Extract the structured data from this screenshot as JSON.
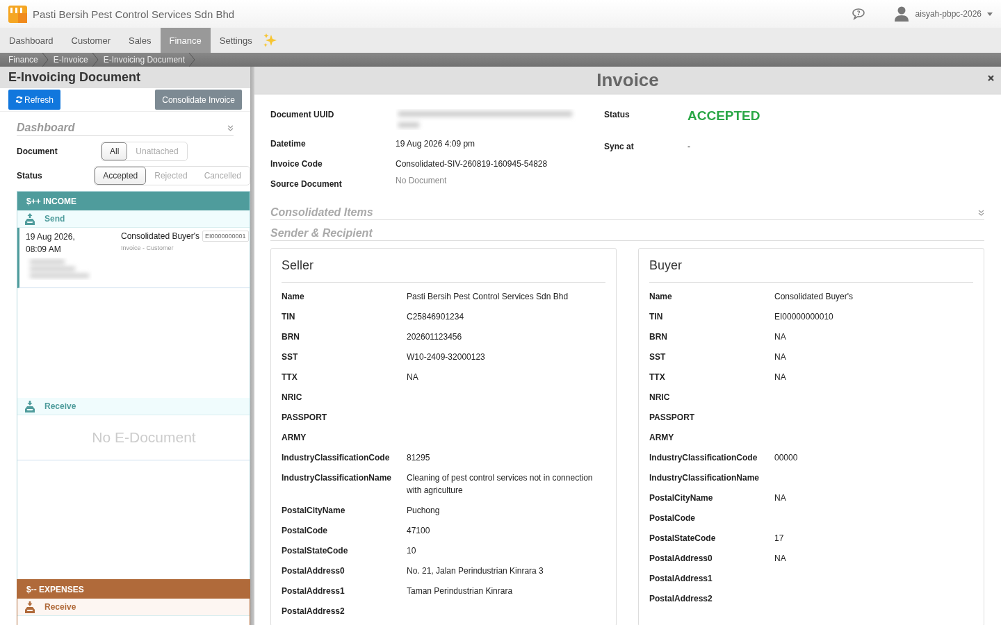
{
  "app": {
    "name": "Pasti Bersih Pest Control Services Sdn Bhd"
  },
  "user": {
    "name": "aisyah-pbpc-2026"
  },
  "nav": [
    {
      "label": "Dashboard",
      "selected": false
    },
    {
      "label": "Customer",
      "selected": false
    },
    {
      "label": "Sales",
      "selected": false
    },
    {
      "label": "Finance",
      "selected": true
    },
    {
      "label": "Settings",
      "selected": false
    }
  ],
  "breadcrumbs": [
    "Finance",
    "E-Invoice",
    "E-Invoicing Document"
  ],
  "left": {
    "title": "E-Invoicing Document",
    "refresh": "Refresh",
    "consolidate": "Consolidate Invoice",
    "dashboard": "Dashboard",
    "filters": [
      {
        "label": "Document",
        "options": [
          {
            "label": "All",
            "selected": true
          },
          {
            "label": "Unattached",
            "selected": false
          }
        ]
      },
      {
        "label": "Status",
        "options": [
          {
            "label": "Accepted",
            "selected": true
          },
          {
            "label": "Rejected",
            "selected": false
          },
          {
            "label": "Cancelled",
            "selected": false
          }
        ]
      }
    ],
    "groups": [
      {
        "kind": "income",
        "title": "$++ INCOME",
        "sections": [
          {
            "label": "Send",
            "kind": "send",
            "items": [
              {
                "date": "19 Aug 2026,",
                "time": "08:09 AM",
                "name": "Consolidated Buyer's",
                "tag": "EI0000000001",
                "subtitle": "Invoice - Customer"
              }
            ]
          },
          {
            "label": "Receive",
            "kind": "receive",
            "empty": "No E-Document"
          }
        ]
      },
      {
        "kind": "expenses",
        "title": "$-- EXPENSES",
        "sections": [
          {
            "label": "Receive",
            "kind": "receive"
          }
        ]
      }
    ]
  },
  "modal": {
    "title": "Invoice",
    "fields": [
      {
        "label": "Document UUID",
        "kind": "blurred"
      },
      {
        "label": "Datetime",
        "value": "19 Aug 2026 4:09 pm",
        "kind": "text"
      },
      {
        "label": "Invoice Code",
        "value": "Consolidated-SIV-260819-160945-54828",
        "kind": "text"
      },
      {
        "label": "Source Document",
        "value": "No Document",
        "kind": "muted"
      }
    ],
    "status": {
      "label": "Status",
      "value": "ACCEPTED"
    },
    "sync": {
      "label": "Sync at",
      "value": "-"
    },
    "sections": [
      "Consolidated Items",
      "Sender & Recipient"
    ],
    "parties": [
      {
        "title": "Seller",
        "rows": [
          {
            "label": "Name",
            "value": "Pasti Bersih Pest Control Services Sdn Bhd"
          },
          {
            "label": "TIN",
            "value": "C25846901234"
          },
          {
            "label": "BRN",
            "value": "202601123456"
          },
          {
            "label": "SST",
            "value": "W10-2409-32000123"
          },
          {
            "label": "TTX",
            "value": "NA"
          },
          {
            "label": "NRIC"
          },
          {
            "label": "PASSPORT"
          },
          {
            "label": "ARMY"
          },
          {
            "label": "IndustryClassificationCode",
            "value": "81295"
          },
          {
            "label": "IndustryClassificationName",
            "value": "Cleaning of pest control services not in connection with agriculture"
          },
          {
            "label": "PostalCityName",
            "value": "Puchong"
          },
          {
            "label": "PostalCode",
            "value": "47100"
          },
          {
            "label": "PostalStateCode",
            "value": "10"
          },
          {
            "label": "PostalAddress0",
            "value": "No. 21, Jalan Perindustrian Kinrara 3"
          },
          {
            "label": "PostalAddress1",
            "value": "Taman Perindustrian Kinrara"
          },
          {
            "label": "PostalAddress2"
          }
        ]
      },
      {
        "title": "Buyer",
        "rows": [
          {
            "label": "Name",
            "value": "Consolidated Buyer's"
          },
          {
            "label": "TIN",
            "value": "EI00000000010"
          },
          {
            "label": "BRN",
            "value": "NA"
          },
          {
            "label": "SST",
            "value": "NA"
          },
          {
            "label": "TTX",
            "value": "NA"
          },
          {
            "label": "NRIC"
          },
          {
            "label": "PASSPORT"
          },
          {
            "label": "ARMY"
          },
          {
            "label": "IndustryClassificationCode",
            "value": "00000"
          },
          {
            "label": "IndustryClassificationName"
          },
          {
            "label": "PostalCityName",
            "value": "NA"
          },
          {
            "label": "PostalCode"
          },
          {
            "label": "PostalStateCode",
            "value": "17"
          },
          {
            "label": "PostalAddress0",
            "value": "NA"
          },
          {
            "label": "PostalAddress1"
          },
          {
            "label": "PostalAddress2"
          }
        ]
      }
    ]
  }
}
